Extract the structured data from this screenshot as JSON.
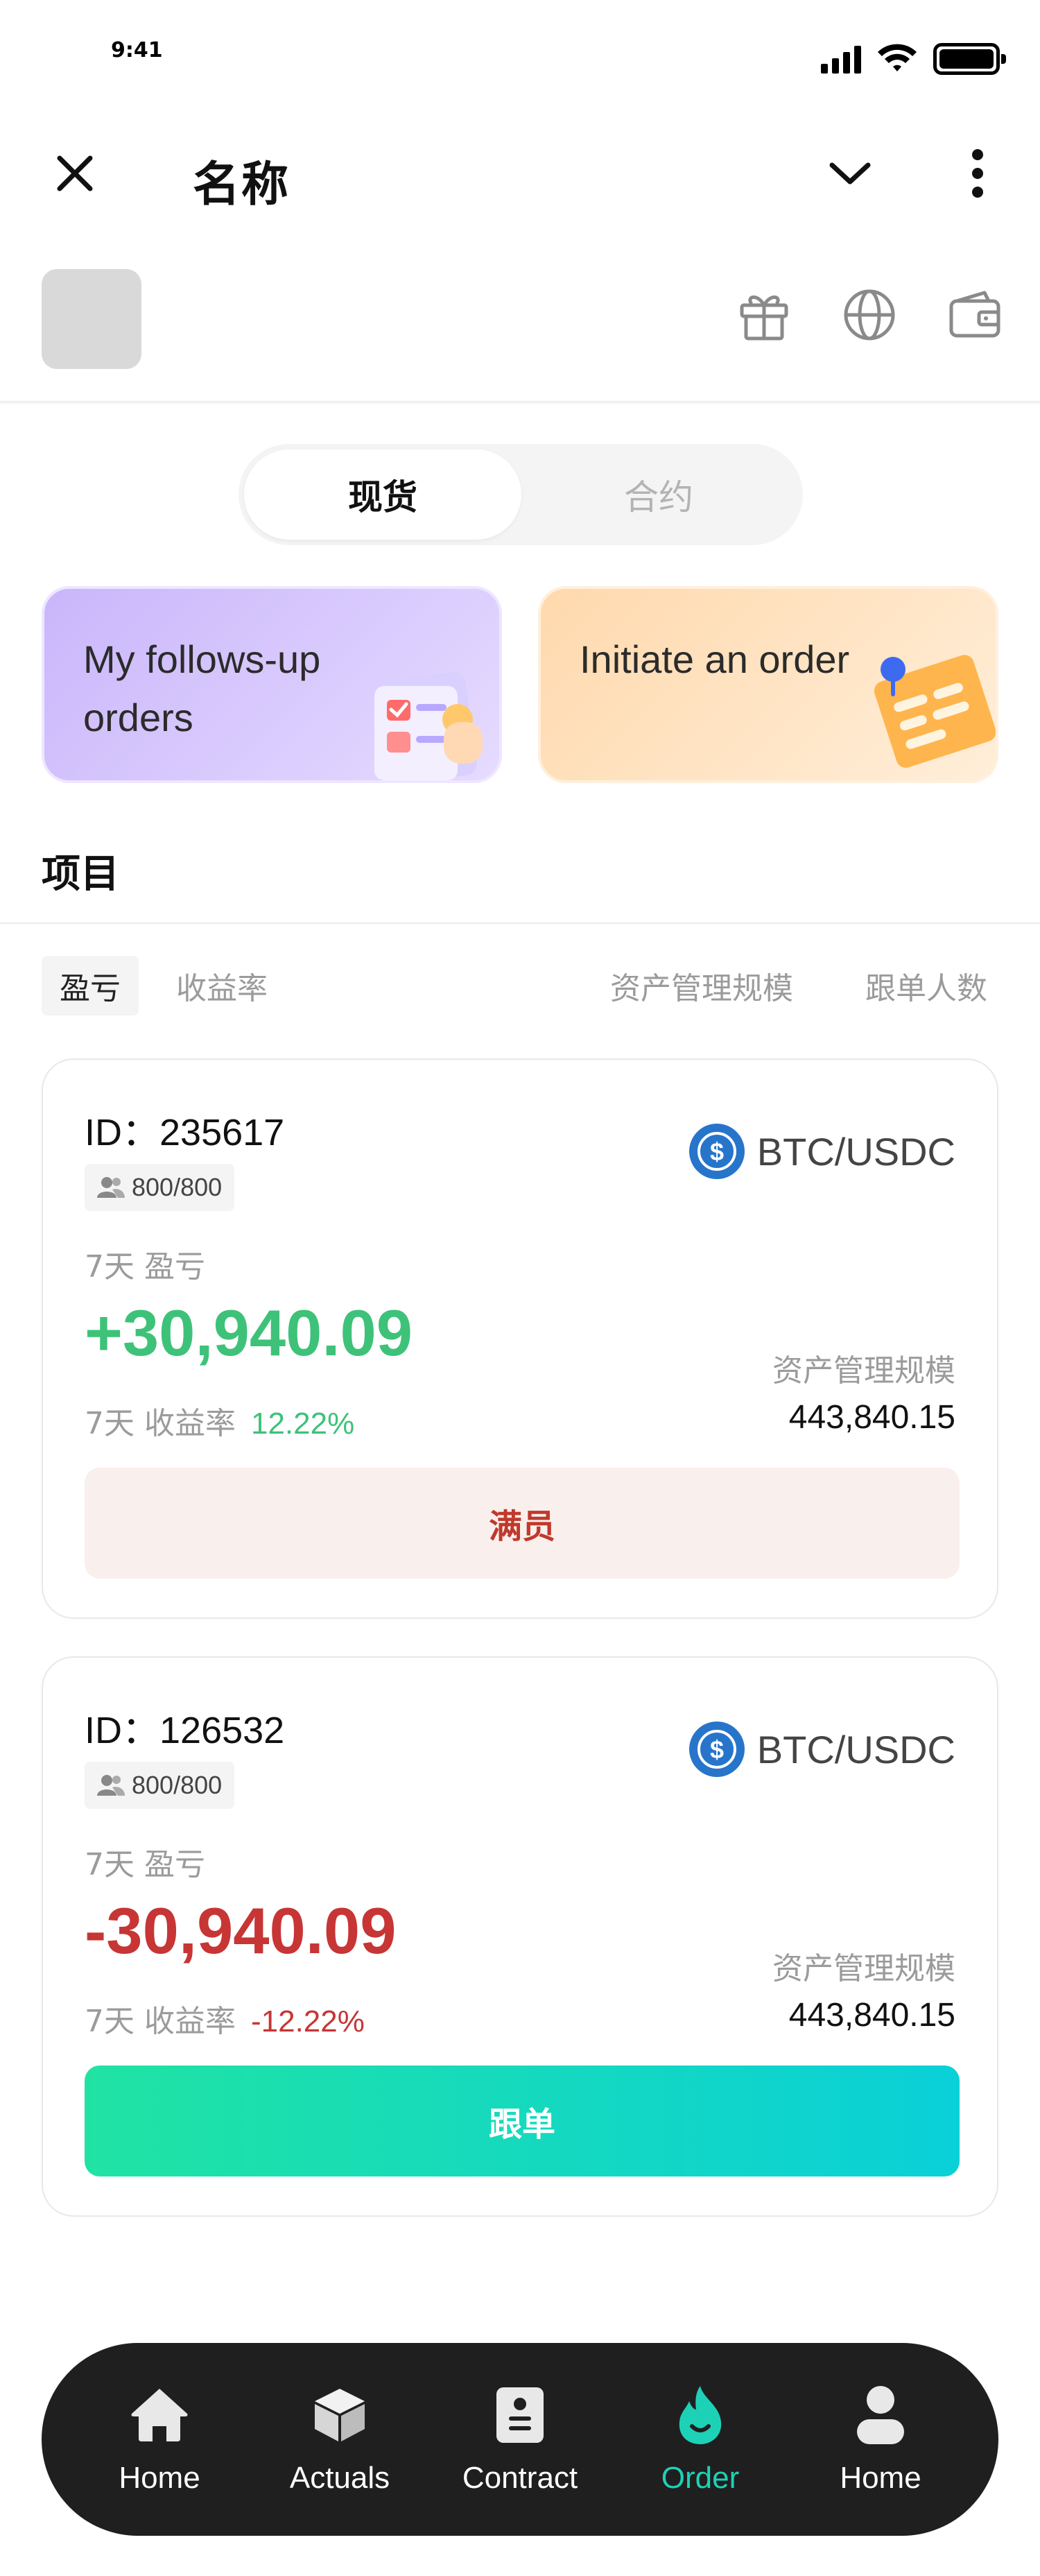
{
  "status_bar": {
    "time": "9:41"
  },
  "header": {
    "title": "名称"
  },
  "segment": {
    "tabs": [
      "现货",
      "合约"
    ],
    "active_index": 0
  },
  "features": [
    {
      "label": "My follows-up orders"
    },
    {
      "label": "Initiate an order"
    }
  ],
  "section": {
    "title": "项目"
  },
  "sort_tabs": [
    "盈亏",
    "收益率",
    "资产管理规模",
    "跟单人数"
  ],
  "cards": [
    {
      "id": "ID：235617",
      "followers": "800/800",
      "pair": "BTC/USDC",
      "pnl_label": "7天 盈亏",
      "pnl_value": "+30,940.09",
      "roi_label": "7天 收益率",
      "roi_value": "12.22%",
      "aum_label": "资产管理规模",
      "aum_value": "443,840.15",
      "button": "满员"
    },
    {
      "id": "ID：126532",
      "followers": "800/800",
      "pair": "BTC/USDC",
      "pnl_label": "7天 盈亏",
      "pnl_value": "-30,940.09",
      "roi_label": "7天 收益率",
      "roi_value": "-12.22%",
      "aum_label": "资产管理规模",
      "aum_value": "443,840.15",
      "button": "跟单"
    }
  ],
  "nav": [
    {
      "label": "Home",
      "icon": "home-icon"
    },
    {
      "label": "Actuals",
      "icon": "cube-icon"
    },
    {
      "label": "Contract",
      "icon": "document-icon"
    },
    {
      "label": "Order",
      "icon": "flame-icon",
      "active": true
    },
    {
      "label": "Home",
      "icon": "profile-icon"
    }
  ],
  "colors": {
    "positive": "#3ec279",
    "negative": "#c73535",
    "accent": "#1dd1b7",
    "nav_bg": "#1f1f1f"
  }
}
